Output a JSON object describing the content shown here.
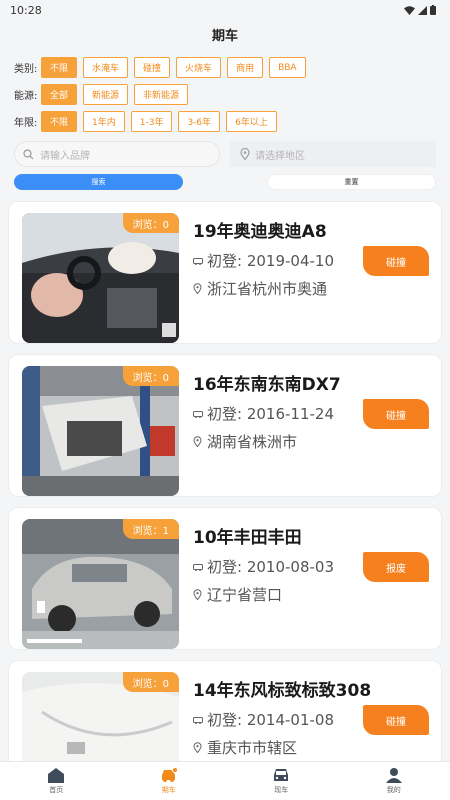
{
  "status": {
    "time": "10:28"
  },
  "header": {
    "title": "期车"
  },
  "filters": [
    {
      "label": "类别:",
      "options": [
        "不限",
        "水淹车",
        "碰撞",
        "火烧车",
        "商用",
        "BBA"
      ],
      "selected": 0
    },
    {
      "label": "能源:",
      "options": [
        "全部",
        "新能源",
        "非新能源"
      ],
      "selected": 0
    },
    {
      "label": "年限:",
      "options": [
        "不限",
        "1年内",
        "1-3年",
        "3-6年",
        "6年以上"
      ],
      "selected": 0
    }
  ],
  "search": {
    "brand_placeholder": "请输入品牌",
    "region_placeholder": "请选择地区"
  },
  "actions": {
    "search_label": "搜索",
    "reset_label": "重置"
  },
  "cars": [
    {
      "views": "浏览：0",
      "title": "19年奥迪奥迪A8",
      "reg": "初登: 2019-04-10",
      "location": "浙江省杭州市奥通",
      "tag": "碰撞"
    },
    {
      "views": "浏览：0",
      "title": "16年东南东南DX7",
      "reg": "初登: 2016-11-24",
      "location": "湖南省株洲市",
      "tag": "碰撞"
    },
    {
      "views": "浏览：1",
      "title": "10年丰田丰田",
      "reg": "初登: 2010-08-03",
      "location": "辽宁省营口",
      "tag": "报废"
    },
    {
      "views": "浏览：0",
      "title": "14年东风标致标致308",
      "reg": "初登: 2014-01-08",
      "location": "重庆市市辖区",
      "tag": "碰撞"
    }
  ],
  "tabs": [
    {
      "label": "首页",
      "icon": "home-icon"
    },
    {
      "label": "期车",
      "icon": "car-badge-icon"
    },
    {
      "label": "现车",
      "icon": "car-front-icon"
    },
    {
      "label": "我的",
      "icon": "person-icon"
    }
  ],
  "colors": {
    "accent": "#f6a13a",
    "tag": "#f6801e",
    "primary": "#3a8ef6"
  }
}
